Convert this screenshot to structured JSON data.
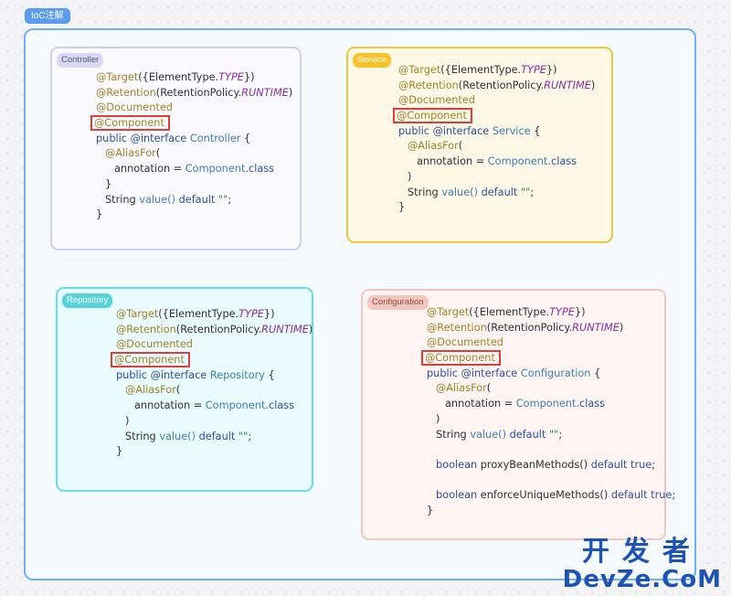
{
  "root_label": "IoC注解",
  "cards": {
    "controller": {
      "label": "Controller",
      "lines": [
        {
          "annotation": "@Target",
          "rest": "({ElementType.",
          "italic": "TYPE",
          "tail": "})"
        },
        {
          "annotation": "@Retention",
          "rest": "(RetentionPolicy.",
          "italic": "RUNTIME",
          "tail": ")"
        },
        {
          "annotation": "@Documented"
        },
        {
          "annotation": "@Component"
        },
        {
          "kw": "public @interface",
          "name": "Controller",
          "tail": " {"
        },
        {
          "annotation": "@AliasFor",
          "tail": "("
        },
        {
          "plain": "annotation = ",
          "type": "Component",
          "type_tail": ".class"
        },
        {
          "plain": "}"
        },
        {
          "plain": "String ",
          "method": "value()",
          "kw_tail": " default ",
          "str": "\"\"",
          "end": ";"
        },
        {
          "plain": "}"
        }
      ]
    },
    "service": {
      "label": "Service",
      "lines": [
        {
          "annotation": "@Target",
          "rest": "({ElementType.",
          "italic": "TYPE",
          "tail": "})"
        },
        {
          "annotation": "@Retention",
          "rest": "(RetentionPolicy.",
          "italic": "RUNTIME",
          "tail": ")"
        },
        {
          "annotation": "@Documented"
        },
        {
          "annotation": "@Component"
        },
        {
          "kw": "public @interface",
          "name": "Service",
          "tail": " {"
        },
        {
          "annotation": "@AliasFor",
          "tail": "("
        },
        {
          "plain": "annotation = ",
          "type": "Component",
          "type_tail": ".class"
        },
        {
          "plain": ")"
        },
        {
          "plain": "String ",
          "method": "value()",
          "kw_tail": " default ",
          "str": "\"\"",
          "end": ";"
        },
        {
          "plain": "}"
        }
      ]
    },
    "repository": {
      "label": "Repository",
      "lines": [
        {
          "annotation": "@Target",
          "rest": "({ElementType.",
          "italic": "TYPE",
          "tail": "})"
        },
        {
          "annotation": "@Retention",
          "rest": "(RetentionPolicy.",
          "italic": "RUNTIME",
          "tail": ")"
        },
        {
          "annotation": "@Documented"
        },
        {
          "annotation": "@Component"
        },
        {
          "kw": "public @interface",
          "name": "Repository",
          "tail": " {"
        },
        {
          "annotation": "@AliasFor",
          "tail": "("
        },
        {
          "plain": "annotation = ",
          "type": "Component",
          "type_tail": ".class"
        },
        {
          "plain": ")"
        },
        {
          "plain": "String ",
          "method": "value()",
          "kw_tail": " default ",
          "str": "\"\"",
          "end": ";"
        },
        {
          "plain": "}"
        }
      ]
    },
    "configuration": {
      "label": "Configuration",
      "lines": [
        {
          "annotation": "@Target",
          "rest": "({ElementType.",
          "italic": "TYPE",
          "tail": "})"
        },
        {
          "annotation": "@Retention",
          "rest": "(RetentionPolicy.",
          "italic": "RUNTIME",
          "tail": ")"
        },
        {
          "annotation": "@Documented"
        },
        {
          "annotation": "@Component"
        },
        {
          "kw": "public @interface",
          "name": "Configuration",
          "tail": " {"
        },
        {
          "annotation": "@AliasFor",
          "tail": "("
        },
        {
          "plain": "annotation = ",
          "type": "Component",
          "type_tail": ".class"
        },
        {
          "plain": ")"
        },
        {
          "plain": "String ",
          "method": "value()",
          "kw_tail": " default ",
          "str": "\"\"",
          "end": ";"
        },
        {
          "plain": ""
        },
        {
          "kw2": "boolean",
          "plain2": " proxyBeanMethods() ",
          "kw3": "default true",
          "end": ";"
        },
        {
          "plain": ""
        },
        {
          "kw2": "boolean",
          "plain2": " enforceUniqueMethods() ",
          "kw3": "default true",
          "end": ";"
        },
        {
          "plain": "}"
        }
      ]
    }
  },
  "watermark": {
    "cn": "开发者",
    "en": "DevZe.CoM"
  },
  "colors": {
    "outer_border": "#6eb0ff",
    "highlight": "#e23b3b",
    "annotation": "#a08226",
    "keyword": "#2c4ea3"
  }
}
